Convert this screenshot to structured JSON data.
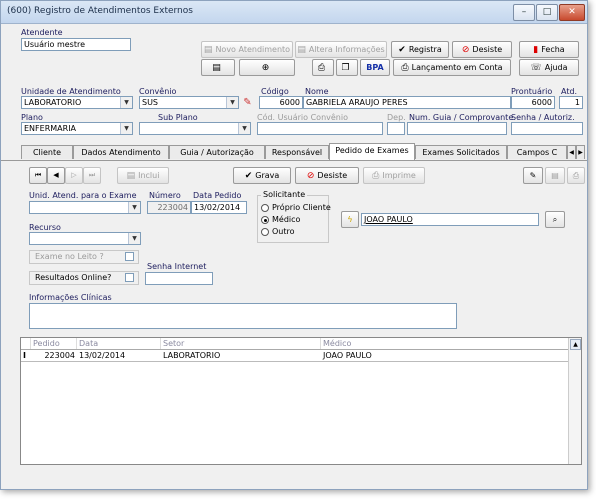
{
  "window": {
    "title": "(600) Registro de Atendimentos Externos",
    "min": "–",
    "max": "□",
    "close": "✕"
  },
  "toolbar": {
    "novo_atendimento": "Novo Atendimento",
    "altera_informacoes": "Altera Informações",
    "registra": "Registra",
    "desiste": "Desiste",
    "fecha": "Fecha",
    "bpa": "BPA",
    "lancamento_em_conta": "Lançamento em Conta",
    "ajuda": "Ajuda"
  },
  "atendente": {
    "label": "Atendente",
    "value": "Usuário mestre"
  },
  "unidade_atendimento": {
    "label": "Unidade de Atendimento",
    "value": "LABORATORIO"
  },
  "convenio": {
    "label": "Convênio",
    "value": "SUS"
  },
  "codigo": {
    "label": "Código",
    "value": "6000"
  },
  "nome": {
    "label": "Nome",
    "value": "GABRIELA ARAUJO PERES"
  },
  "prontuario": {
    "label": "Prontuário",
    "value": "6000"
  },
  "atd": {
    "label": "Atd.",
    "value": "1"
  },
  "plano": {
    "label": "Plano",
    "value": "ENFERMARIA"
  },
  "sub_plano": {
    "label": "Sub Plano",
    "value": ""
  },
  "cod_usuario_convenio": {
    "label": "Cód. Usuário Convênio",
    "value": ""
  },
  "dep": {
    "label": "Dep.",
    "value": ""
  },
  "num_guia": {
    "label": "Num. Guia / Comprovante",
    "value": ""
  },
  "senha_autoriz": {
    "label": "Senha / Autoriz.",
    "value": ""
  },
  "tabs": [
    {
      "label": "Cliente"
    },
    {
      "label": "Dados Atendimento"
    },
    {
      "label": "Guia / Autorização"
    },
    {
      "label": "Responsável"
    },
    {
      "label": "Pedido de Exames"
    },
    {
      "label": "Exames Solicitados"
    },
    {
      "label": "Campos C"
    }
  ],
  "pedido": {
    "inclui": "Inclui",
    "grava": "Grava",
    "desiste": "Desiste",
    "imprime": "Imprime",
    "unid_label": "Unid. Atend. para o Exame",
    "unid_value": "",
    "numero_label": "Número",
    "numero_value": "223004",
    "data_label": "Data Pedido",
    "data_value": "13/02/2014",
    "solicitante_label": "Solicitante",
    "solicitante_options": [
      "Próprio Cliente",
      "Médico",
      "Outro"
    ],
    "solicitante_selected": "Médico",
    "medico_value": "JOAO PAULO",
    "recurso_label": "Recurso",
    "recurso_value": "",
    "exame_no_leito": "Exame no Leito ?",
    "resultados_online": "Resultados Online?",
    "senha_internet_label": "Senha Internet",
    "senha_internet_value": "",
    "informacoes_clinicas_label": "Informações Clínicas",
    "informacoes_clinicas_value": ""
  },
  "grid": {
    "columns": [
      "Pedido",
      "Data",
      "Setor",
      "Médico"
    ],
    "rows": [
      {
        "pedido": "223004",
        "data": "13/02/2014",
        "setor": "LABORATORIO",
        "medico": "JOAO PAULO"
      }
    ]
  },
  "colors": {
    "label_blue": "#202060",
    "title_gradient_top": "#dbe7f5",
    "close_red": "#c84a2e"
  },
  "icons": [
    "doc-icon",
    "zoom-icon",
    "printer-icon",
    "copy-icon",
    "check-icon",
    "stop-icon",
    "door-icon",
    "help-icon",
    "flash-icon",
    "search-person-icon",
    "nav-first-icon",
    "nav-prev-icon",
    "nav-next-icon",
    "nav-last-icon"
  ]
}
